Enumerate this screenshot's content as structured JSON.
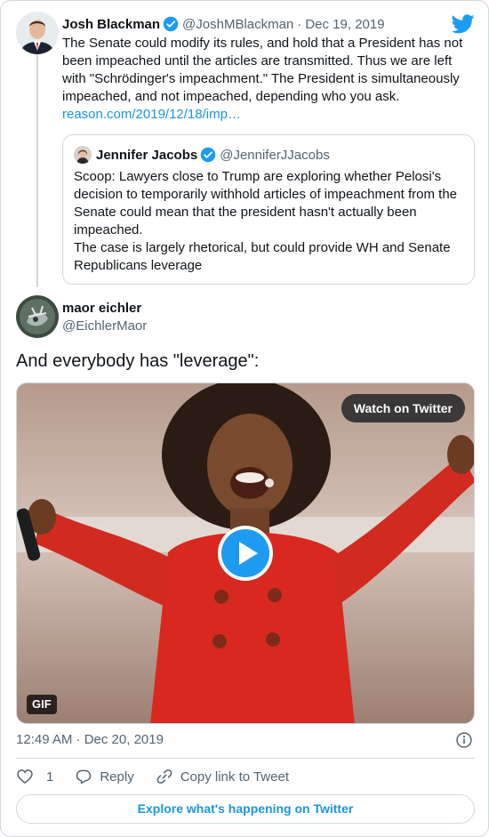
{
  "reply_tweet": {
    "author_name": "Josh Blackman",
    "author_handle": "@JoshMBlackman",
    "separator": "·",
    "date": "Dec 19, 2019",
    "text_lines": [
      "The Senate could modify its rules, and hold that a President has not",
      "been impeached until the articles are transmitted. Thus we are left",
      "with \"Schrödinger's impeachment.\" The President is simultaneously",
      "impeached, and not impeached, depending who you ask."
    ],
    "link": "reason.com/2019/12/18/imp…"
  },
  "quoted_tweet": {
    "author_name": "Jennifer Jacobs",
    "author_handle": "@JenniferJJacobs",
    "text_lines": [
      "Scoop: Lawyers close to Trump are exploring whether Pelosi's",
      "decision to temporarily withhold articles of impeachment from the",
      "Senate could mean that the president hasn't actually been",
      "impeached.",
      "The case is largely rhetorical, but could provide WH and Senate",
      "Republicans leverage"
    ]
  },
  "main_tweet": {
    "author_name": "maor eichler",
    "author_handle": "@EichlerMaor",
    "text": "And everybody has \"leverage\":",
    "media": {
      "watch_label": "Watch on Twitter",
      "badge": "GIF"
    },
    "timestamp": "12:49 AM · Dec 20, 2019",
    "like_count": "1",
    "reply_label": "Reply",
    "copy_link_label": "Copy link to Tweet",
    "explore_label": "Explore what's happening on Twitter"
  },
  "colors": {
    "accent": "#1b95e0",
    "verified": "#1d9bf0",
    "secondary_text": "#536471",
    "border": "#cfd9de",
    "dress_red": "#d9281f"
  },
  "icons": {
    "brand": "twitter-bird-icon",
    "verified": "verified-badge-icon",
    "play": "play-icon",
    "info": "info-icon",
    "like": "heart-icon",
    "reply": "reply-bubble-icon",
    "copy": "link-icon"
  }
}
